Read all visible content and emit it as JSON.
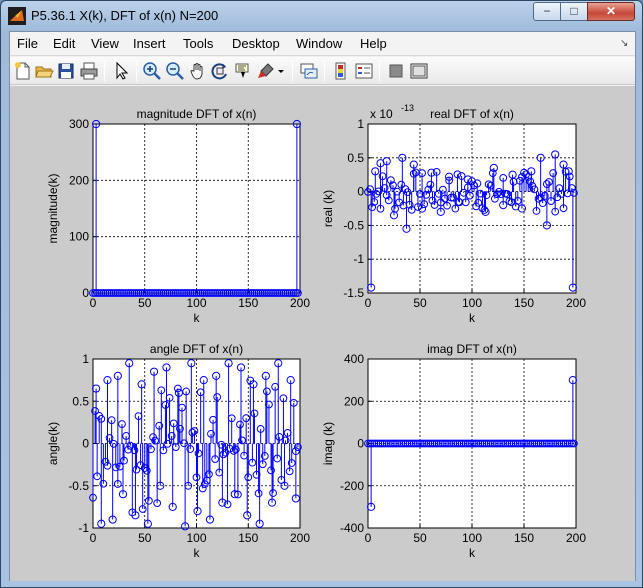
{
  "window": {
    "title": "P5.36.1 X(k), DFT of x(n) N=200",
    "buttons": {
      "minimize": "−",
      "maximize": "□",
      "close": "✕"
    }
  },
  "menubar": [
    "File",
    "Edit",
    "View",
    "Insert",
    "Tools",
    "Desktop",
    "Window",
    "Help"
  ],
  "toolbar": [
    "new-figure-icon",
    "open-file-icon",
    "save-icon",
    "print-icon",
    "edit-plot-arrow-icon",
    "zoom-in-icon",
    "zoom-out-icon",
    "pan-hand-icon",
    "rotate-3d-icon",
    "data-cursor-icon",
    "brush-icon",
    "link-plot-icon",
    "colorbar-icon",
    "legend-icon",
    "hide-plot-tools-icon",
    "show-plot-tools-icon"
  ],
  "colors": {
    "stem": "#0000ff",
    "axes_bg": "#ffffff",
    "figure_bg": "#cbcbcb"
  },
  "chart_data": [
    {
      "type": "stem",
      "title": "magnitude DFT of x(n)",
      "xlabel": "k",
      "ylabel": "magnitude(k)",
      "xlim": [
        0,
        200
      ],
      "ylim": [
        0,
        300
      ],
      "xticks": [
        "0",
        "50",
        "100",
        "150",
        "200"
      ],
      "yticks": [
        "0",
        "100",
        "200",
        "300"
      ],
      "grid": true,
      "x": [
        3,
        197
      ],
      "values": [
        300,
        300
      ],
      "note_other_k": "all other k values approximately 0"
    },
    {
      "type": "stem",
      "title": "real DFT of x(n)",
      "xlabel": "k",
      "ylabel": "real (k)",
      "multiplier": "x 10",
      "exponent": "-13",
      "xlim": [
        0,
        200
      ],
      "ylim": [
        -1.5,
        1
      ],
      "xticks": [
        "0",
        "50",
        "100",
        "150",
        "200"
      ],
      "yticks": [
        "-1.5",
        "-1",
        "-0.5",
        "0",
        "0.5",
        "1"
      ],
      "grid": true,
      "x": [
        3,
        7,
        12,
        18,
        25,
        33,
        37,
        44,
        52,
        61,
        70,
        78,
        87,
        96,
        105,
        113,
        121,
        130,
        139,
        148,
        157,
        166,
        172,
        180,
        188,
        193,
        197
      ],
      "values": [
        -1.42,
        0.3,
        0.42,
        0.45,
        -0.35,
        0.5,
        -0.55,
        0.4,
        -0.25,
        0.28,
        -0.3,
        0.22,
        -0.15,
        0.18,
        0.12,
        -0.3,
        0.35,
        -0.2,
        0.25,
        -0.25,
        0.3,
        0.5,
        -0.5,
        0.55,
        0.4,
        0.3,
        -1.42
      ]
    },
    {
      "type": "stem",
      "title": "angle DFT of x(n)",
      "xlabel": "k",
      "ylabel": "angle(k)",
      "xlim": [
        0,
        200
      ],
      "ylim": [
        -1,
        1
      ],
      "xticks": [
        "0",
        "50",
        "100",
        "150",
        "200"
      ],
      "yticks": [
        "-1",
        "-0.5",
        "0",
        "0.5",
        "1"
      ],
      "grid": true,
      "x": [
        3,
        8,
        14,
        19,
        24,
        29,
        35,
        41,
        47,
        53,
        59,
        65,
        71,
        77,
        83,
        89,
        95,
        101,
        107,
        113,
        119,
        125,
        131,
        137,
        143,
        149,
        155,
        161,
        167,
        173,
        179,
        185,
        191,
        196
      ],
      "values": [
        0.65,
        -0.95,
        0.75,
        -0.9,
        0.8,
        -0.6,
        0.95,
        -0.85,
        0.7,
        -0.95,
        0.85,
        -0.5,
        0.9,
        -0.75,
        0.6,
        -0.98,
        0.95,
        -0.8,
        0.75,
        -0.9,
        0.8,
        -0.7,
        0.95,
        -0.6,
        0.9,
        -0.85,
        0.7,
        -0.95,
        0.8,
        -0.7,
        0.95,
        -0.5,
        0.75,
        -0.65
      ]
    },
    {
      "type": "stem",
      "title": "imag DFT of x(n)",
      "xlabel": "k",
      "ylabel": "imag (k)",
      "xlim": [
        0,
        200
      ],
      "ylim": [
        -400,
        400
      ],
      "xticks": [
        "0",
        "50",
        "100",
        "150",
        "200"
      ],
      "yticks": [
        "-400",
        "-200",
        "0",
        "200",
        "400"
      ],
      "grid": true,
      "x": [
        3,
        197
      ],
      "values": [
        -300,
        300
      ],
      "note_other_k": "all other k values approximately 0"
    }
  ]
}
